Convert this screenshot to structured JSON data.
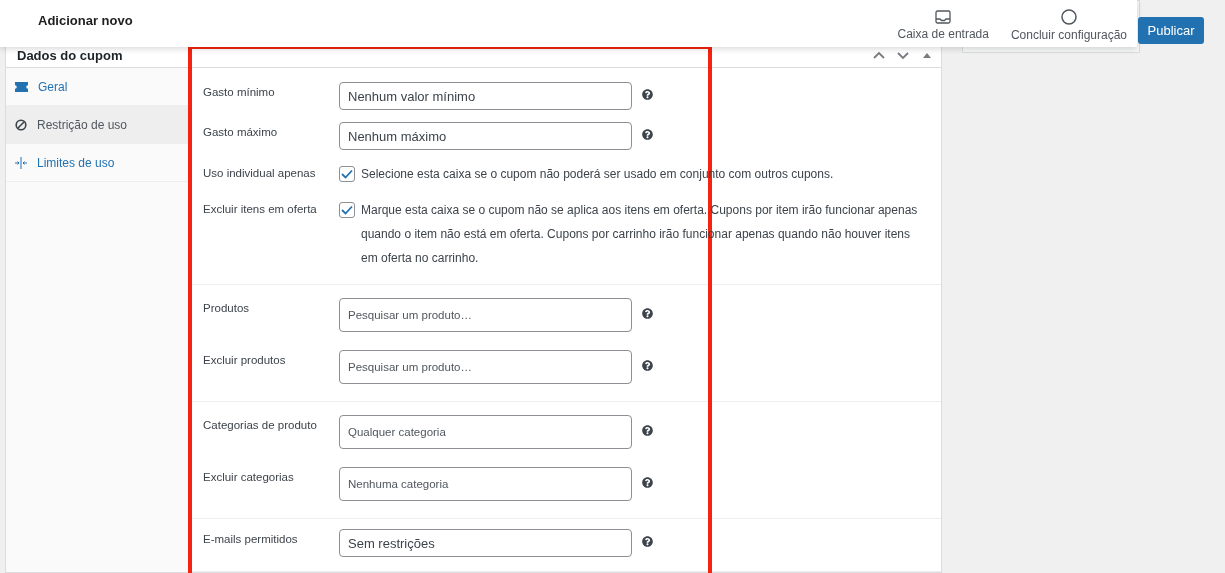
{
  "header": {
    "title": "Adicionar novo",
    "actions": [
      {
        "label": "Caixa de entrada",
        "kind": "inbox"
      },
      {
        "label": "Concluir configuração",
        "kind": "progress"
      }
    ],
    "publish_button": "Publicar"
  },
  "panel": {
    "title": "Dados do cupom"
  },
  "tabs": [
    {
      "label": "Geral",
      "kind": "ticket",
      "selected": false
    },
    {
      "label": "Restrição de uso",
      "kind": "ban",
      "selected": true
    },
    {
      "label": "Limites de uso",
      "kind": "limits",
      "selected": false
    }
  ],
  "sections": [
    {
      "rows": [
        {
          "kind": "text",
          "label": "Gasto mínimo",
          "placeholder": "Nenhum valor mínimo"
        },
        {
          "kind": "text",
          "label": "Gasto máximo",
          "placeholder": "Nenhum máximo"
        },
        {
          "kind": "checkbox",
          "label": "Uso individual apenas",
          "checked": true,
          "description": "Selecione esta caixa se o cupom não poderá ser usado em conjunto com outros cupons."
        },
        {
          "kind": "checkbox",
          "label": "Excluir itens em oferta",
          "checked": true,
          "description": "Marque esta caixa se o cupom não se aplica aos itens em oferta. Cupons por item irão funcionar apenas quando o item não está em oferta. Cupons por carrinho irão funcionar apenas quando não houver itens em oferta no carrinho."
        }
      ]
    },
    {
      "rows": [
        {
          "kind": "select",
          "label": "Produtos",
          "placeholder": "Pesquisar um produto…"
        },
        {
          "kind": "select",
          "label": "Excluir produtos",
          "placeholder": "Pesquisar um produto…"
        }
      ]
    },
    {
      "rows": [
        {
          "kind": "select",
          "label": "Categorias de produto",
          "placeholder": "Qualquer categoria"
        },
        {
          "kind": "select",
          "label": "Excluir categorias",
          "placeholder": "Nenhuma categoria"
        }
      ]
    },
    {
      "rows": [
        {
          "kind": "text",
          "label": "E-mails permitidos",
          "placeholder": "Sem restrições"
        }
      ]
    }
  ]
}
